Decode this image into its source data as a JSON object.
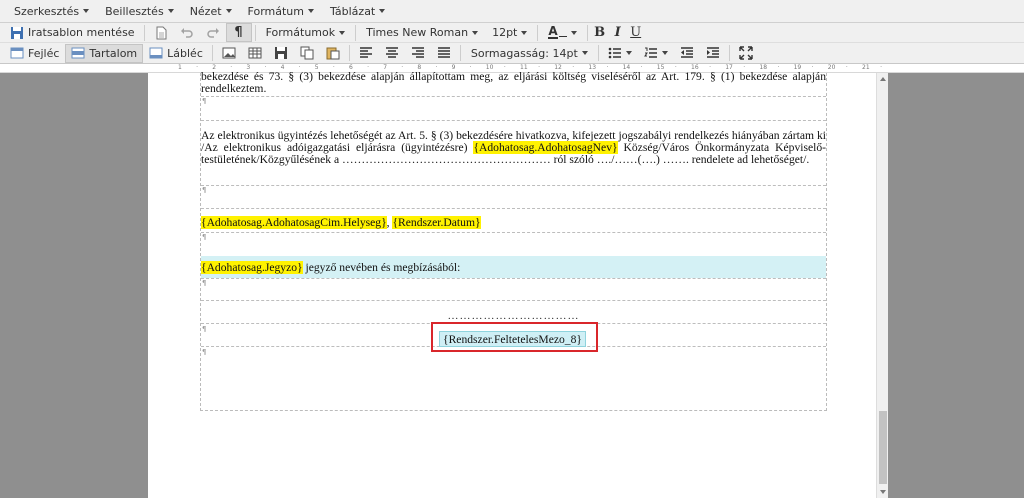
{
  "menubar": {
    "items": [
      "Szerkesztés",
      "Beillesztés",
      "Nézet",
      "Formátum",
      "Táblázat"
    ]
  },
  "toolbar1": {
    "save_template": "Iratsablon mentése",
    "pilcrow": "¶",
    "formats": "Formátumok",
    "font_family": "Times New Roman",
    "font_size": "12pt",
    "font_color": "A",
    "bold": "B",
    "italic": "I",
    "underline": "U"
  },
  "toolbar2": {
    "header": "Fejléc",
    "content": "Tartalom",
    "footer": "Lábléc",
    "line_height": "Sormagasság: 14pt"
  },
  "ruler": {
    "marks": [
      "1",
      "2",
      "3",
      "4",
      "5",
      "6",
      "7",
      "8",
      "9",
      "10",
      "11",
      "12",
      "13",
      "14",
      "15",
      "16",
      "17",
      "18",
      "19",
      "20",
      "21"
    ]
  },
  "document": {
    "p1": {
      "text": "bekezdése és 73. § (3) bekezdése alapján állapítottam meg, az eljárási költség viseléséről az Art. 179. § (1) bekezdése alapján rendelkeztem."
    },
    "p2": {
      "text_before": "Az elektronikus ügyintézés lehetőségét az Art. 5. § (3) bekezdésére hivatkozva, kifejezett jogszabályi rendelkezés hiányában zártam ki /Az elektronikus adóigazgatási eljárásra (ügyintézésre) ",
      "placeholder": "{Adohatosag.AdohatosagNev}",
      "text_after": " Község/Város Önkormányzata Képviselő-testületének/Közgyűlésének a ……………………………………………… ról szóló …./……(….) ……. rendelete ad lehetőséget/."
    },
    "p3": {
      "placeholder_city": "{Adohatosag.AdohatosagCim.Helyseg}",
      "separator": ", ",
      "placeholder_date": "{Rendszer.Datum}"
    },
    "p4": {
      "placeholder": "{Adohatosag.Jegyzo}",
      "text_after": " jegyző nevében és megbízásából:"
    },
    "signature_line": "……………………………",
    "conditional_field": "{Rendszer.FeltetelesMezo_8}",
    "colors": {
      "placeholder_highlight": "#fff200",
      "selection_row": "#d4f1f5",
      "annotation_box": "#d9262b"
    }
  }
}
